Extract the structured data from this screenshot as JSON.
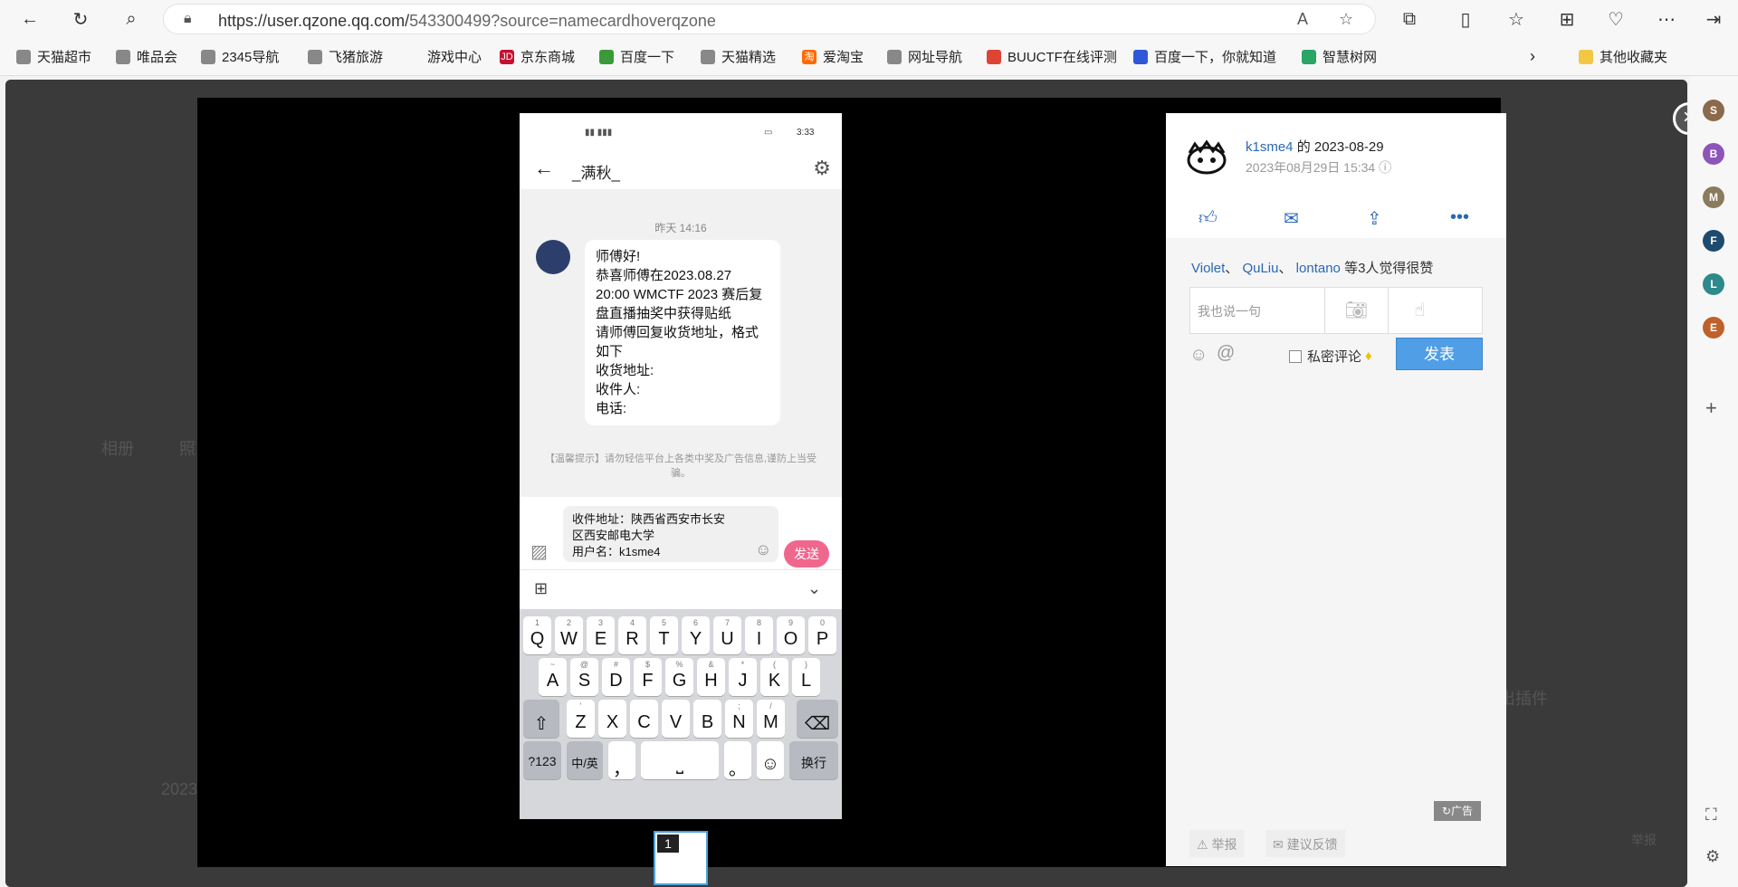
{
  "browser": {
    "url_host": "https://user.qzone.qq.com/",
    "url_path": "543300499?source=namecardhoverqzone",
    "icons": [
      "back-icon",
      "refresh-icon",
      "search-icon",
      "lock-icon",
      "read-aloud-icon",
      "star-icon",
      "extensions-icon",
      "split-screen-icon",
      "favorites-icon",
      "collections-icon",
      "performance-icon",
      "more-icon",
      "sidebar-toggle-icon"
    ],
    "more_badge": "1"
  },
  "bookmarks": [
    "天猫超市",
    "唯品会",
    "2345导航",
    "飞猪旅游",
    "游戏中心",
    "京东商城",
    "百度一下",
    "天猫精选",
    "爱淘宝",
    "网址导航",
    "BUUCTF在线评测",
    "百度一下，你就知道",
    "智慧树网"
  ],
  "bookmarks_other": "其他收藏夹",
  "sidebar": {
    "avatars": [
      {
        "letter": "S",
        "color": "#8a6a4a"
      },
      {
        "letter": "B",
        "color": "#8e55b8"
      },
      {
        "letter": "M",
        "color": "#8a7a5e"
      },
      {
        "letter": "F",
        "color": "#1e4a6e"
      },
      {
        "letter": "L",
        "color": "#2e8a8a"
      },
      {
        "letter": "E",
        "color": "#c0602a"
      }
    ]
  },
  "phone": {
    "status_time": "3:33",
    "chat_name": "_满秋_",
    "message_time": "昨天 14:16",
    "message_lines": [
      "师傅好!",
      "恭喜师傅在2023.08.27",
      "20:00 WMCTF 2023 赛后复",
      "盘直播抽奖中获得贴纸",
      "请师傅回复收货地址，格式",
      "如下",
      "收货地址:",
      "收件人:",
      "电话:"
    ],
    "tip": "【温馨提示】请勿轻信平台上各类中奖及广告信息,谨防上当受骗。",
    "compose_lines": [
      "收件地址：陕西省西安市长安",
      "区西安邮电大学",
      "用户名：k1sme4"
    ],
    "send_label": "发送",
    "keyboard": {
      "row1": [
        "Q",
        "W",
        "E",
        "R",
        "T",
        "Y",
        "U",
        "I",
        "O",
        "P"
      ],
      "row1_hints": [
        "1",
        "2",
        "3",
        "4",
        "5",
        "6",
        "7",
        "8",
        "9",
        "0"
      ],
      "row2": [
        "A",
        "S",
        "D",
        "F",
        "G",
        "H",
        "J",
        "K",
        "L"
      ],
      "row2_hints": [
        "~",
        "@",
        "#",
        "$",
        "%",
        "&",
        "*",
        "(",
        ")"
      ],
      "row3": [
        "Z",
        "X",
        "C",
        "V",
        "B",
        "N",
        "M"
      ],
      "row3_hints": [
        "'",
        "",
        "",
        "",
        "",
        ";",
        "/"
      ],
      "sym_label": "?123",
      "lang_label": "中/英",
      "comma": "，",
      "period": "。",
      "enter_label": "换行"
    }
  },
  "thumbnail_index": "1",
  "panel": {
    "user": "k1sme4",
    "user_suffix": " 的 2023-08-29",
    "timestamp": "2023年08月29日 15:34",
    "likers": [
      "Violet",
      "QuLiu",
      "lontano"
    ],
    "likes_suffix": "等3人觉得很赞",
    "sep": "、",
    "comment_placeholder": "我也说一句",
    "private_label": "私密评论",
    "post_label": "发表",
    "ad_label": "广告",
    "report_label": "举报",
    "feedback_label": "建议反馈"
  },
  "background_page": {
    "tabs": [
      "相册",
      "照"
    ],
    "date_fragment": "2023-",
    "side_text": "出插件",
    "side_text2": "举报"
  }
}
